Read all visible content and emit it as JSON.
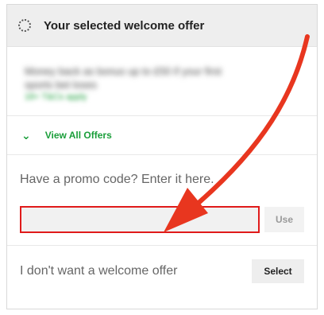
{
  "header": {
    "title": "Your selected welcome offer",
    "icon": "loading-spinner-icon"
  },
  "offer": {
    "line1": "Money back as bonus up to £50 if your first",
    "line2": "sports bet loses",
    "terms": "18+ T&Cs apply"
  },
  "view_all": {
    "label": "View All Offers",
    "icon": "chevron-down-icon"
  },
  "promo": {
    "title": "Have a promo code? Enter it here.",
    "input_value": "",
    "input_placeholder": "",
    "use_label": "Use"
  },
  "decline": {
    "label": "I don't want a welcome offer",
    "select_label": "Select"
  },
  "colors": {
    "accent_green": "#1a9e3a",
    "highlight_red": "#e01b1b",
    "annotation_arrow": "#e8361f"
  }
}
